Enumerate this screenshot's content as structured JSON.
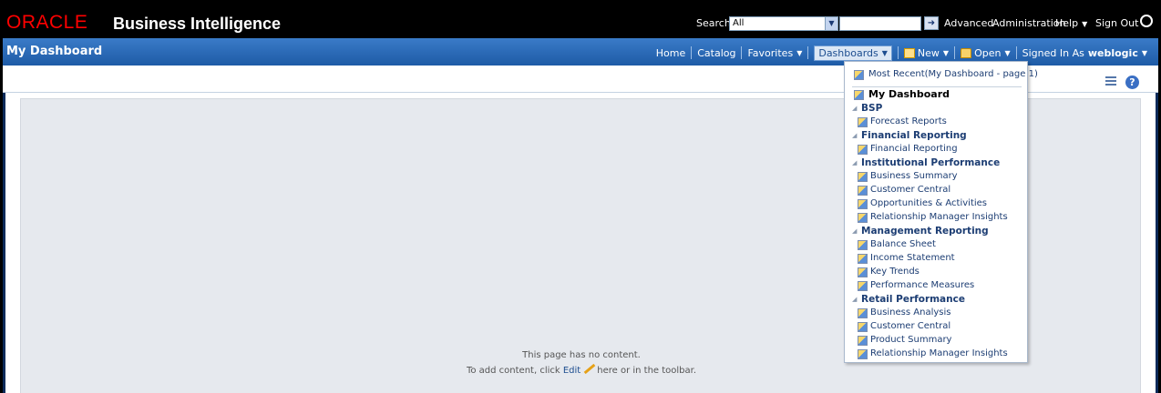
{
  "topbar": {
    "logo": "ORACLE",
    "product": "Business Intelligence",
    "search_label": "Search",
    "search_scope": "All",
    "search_value": "",
    "advanced": "Advanced",
    "administration": "Administration",
    "help": "Help",
    "signout": "Sign Out"
  },
  "header": {
    "title": "My Dashboard",
    "nav": {
      "home": "Home",
      "catalog": "Catalog",
      "favorites": "Favorites",
      "dashboards": "Dashboards",
      "new": "New",
      "open": "Open",
      "signed_in_label": "Signed In As",
      "user": "weblogic"
    }
  },
  "content": {
    "empty_line1": "This page has no content.",
    "empty_prefix": "To add content, click",
    "edit_link": "Edit",
    "empty_suffix": "here or in the toolbar."
  },
  "dashboards_menu": {
    "recent": "Most Recent(My Dashboard - page 1)",
    "my_dashboard": "My Dashboard",
    "groups": [
      {
        "name": "BSP",
        "items": [
          "Forecast Reports"
        ]
      },
      {
        "name": "Financial Reporting",
        "items": [
          "Financial Reporting"
        ]
      },
      {
        "name": "Institutional Performance",
        "items": [
          "Business Summary",
          "Customer Central",
          "Opportunities & Activities",
          "Relationship Manager Insights"
        ]
      },
      {
        "name": "Management Reporting",
        "items": [
          "Balance Sheet",
          "Income Statement",
          "Key Trends",
          "Performance Measures"
        ]
      },
      {
        "name": "Retail Performance",
        "items": [
          "Business Analysis",
          "Customer Central",
          "Product Summary",
          "Relationship Manager Insights"
        ]
      }
    ]
  },
  "colors": {
    "oracle_red": "#ff0000",
    "header_blue": "#1e5ba6",
    "link_blue": "#1c3d73"
  }
}
